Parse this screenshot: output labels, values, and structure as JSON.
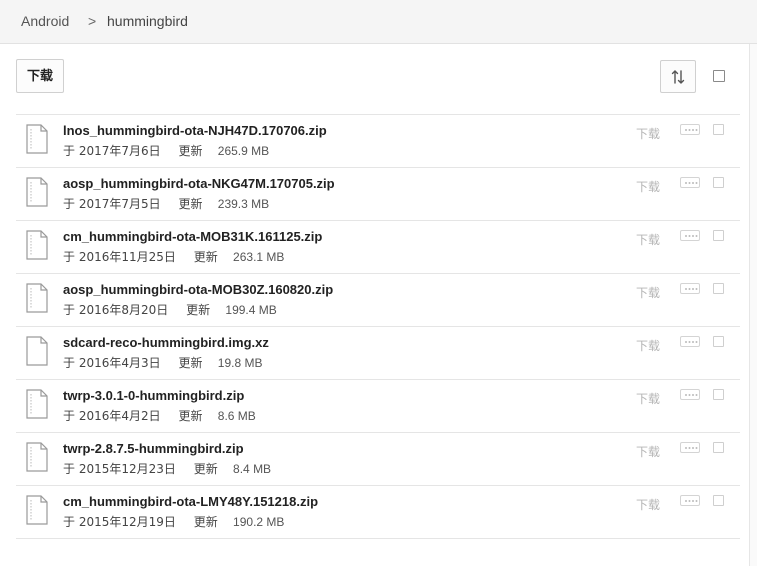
{
  "breadcrumb": {
    "root": "Android",
    "separator": ">",
    "current": "hummingbird"
  },
  "toolbar": {
    "download_label": "下载"
  },
  "row_download_label": "下载",
  "meta_prefix": "于",
  "meta_suffix": "更新",
  "files": [
    {
      "name": "lnos_hummingbird-ota-NJH47D.170706.zip",
      "date": "2017年7月6日",
      "size": "265.9 MB"
    },
    {
      "name": "aosp_hummingbird-ota-NKG47M.170705.zip",
      "date": "2017年7月5日",
      "size": "239.3 MB"
    },
    {
      "name": "cm_hummingbird-ota-MOB31K.161125.zip",
      "date": "2016年11月25日",
      "size": "263.1 MB"
    },
    {
      "name": "aosp_hummingbird-ota-MOB30Z.160820.zip",
      "date": "2016年8月20日",
      "size": "199.4 MB"
    },
    {
      "name": "sdcard-reco-hummingbird.img.xz",
      "date": "2016年4月3日",
      "size": "19.8 MB"
    },
    {
      "name": "twrp-3.0.1-0-hummingbird.zip",
      "date": "2016年4月2日",
      "size": "8.6 MB"
    },
    {
      "name": "twrp-2.8.7.5-hummingbird.zip",
      "date": "2015年12月23日",
      "size": "8.4 MB"
    },
    {
      "name": "cm_hummingbird-ota-LMY48Y.151218.zip",
      "date": "2015年12月19日",
      "size": "190.2 MB"
    }
  ],
  "icons": {
    "file": "file-icon",
    "sort": "sort-icon",
    "more": "more-icon"
  }
}
